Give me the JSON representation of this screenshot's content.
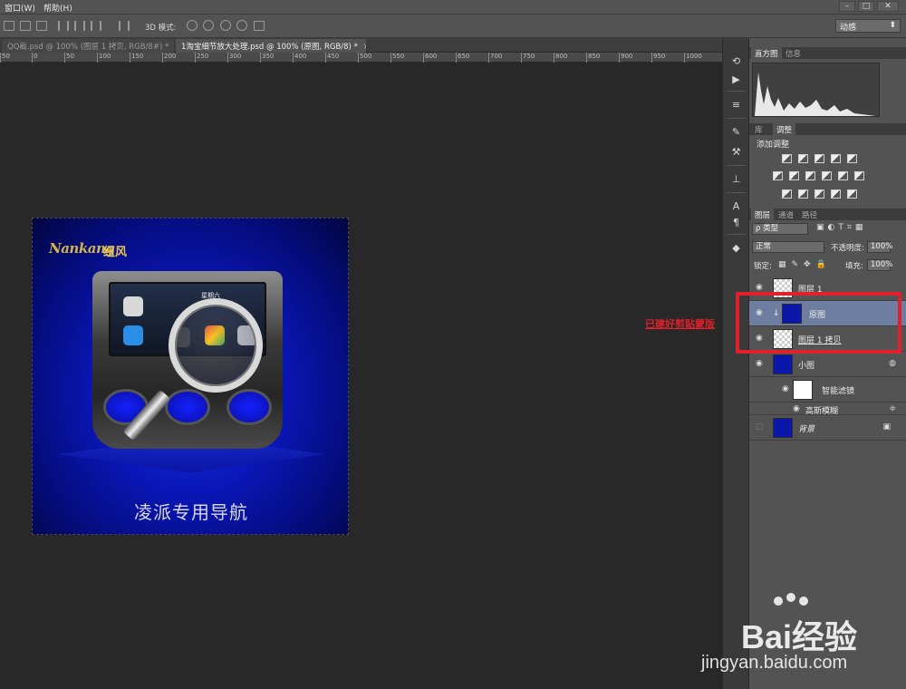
{
  "menubar": {
    "items": [
      "窗口(W)",
      "帮助(H)"
    ],
    "window_buttons": [
      "–",
      "□",
      "✕"
    ]
  },
  "options": {
    "mode3d_label": "3D 模式:",
    "workspace": "动感"
  },
  "tabs": [
    {
      "label": "QQ截.psd @ 100% (图层 1 拷贝, RGB/8#) *",
      "close": "×"
    },
    {
      "label": "1淘宝细节放大处理.psd @ 100% (原图, RGB/8) *",
      "close": "×"
    }
  ],
  "ruler": {
    "ticks": [
      "50",
      "0",
      "50",
      "100",
      "150",
      "200",
      "250",
      "300",
      "350",
      "400",
      "450",
      "500",
      "550",
      "600",
      "650",
      "700",
      "750",
      "800",
      "850",
      "900",
      "950",
      "1000"
    ]
  },
  "document": {
    "logo_text": "Nankang",
    "logo_cn": "纽风",
    "caption": "凌派专用导航",
    "screen_day": "星期六"
  },
  "panels": {
    "histogram_tabs": [
      "直方图",
      "信息"
    ],
    "adjust_tabs": [
      "库",
      "调整"
    ],
    "adjust_title": "添加调整",
    "layers_tabs": [
      "图层",
      "通道",
      "路径"
    ],
    "filter_kind": "ρ 类型",
    "blend_mode": "正常",
    "opacity_label": "不透明度:",
    "opacity_value": "100%",
    "lock_label": "锁定:",
    "fill_label": "填充:",
    "fill_value": "100%",
    "layers": [
      {
        "name": "图层 1"
      },
      {
        "name": "原图"
      },
      {
        "name": "图层 1 拷贝"
      },
      {
        "name": "小图"
      },
      {
        "name": "智能滤镜"
      },
      {
        "name": "高斯模糊"
      },
      {
        "name": "背景"
      }
    ]
  },
  "annotation": {
    "text": "已建好剪贴蒙版"
  },
  "watermark": {
    "brand": "Bai经验",
    "url": "jingyan.baidu.com"
  },
  "colors": {
    "annotation_red": "#e0202a",
    "selected_layer": "#6e7ea0",
    "doc_blue": "#0b17b8"
  }
}
